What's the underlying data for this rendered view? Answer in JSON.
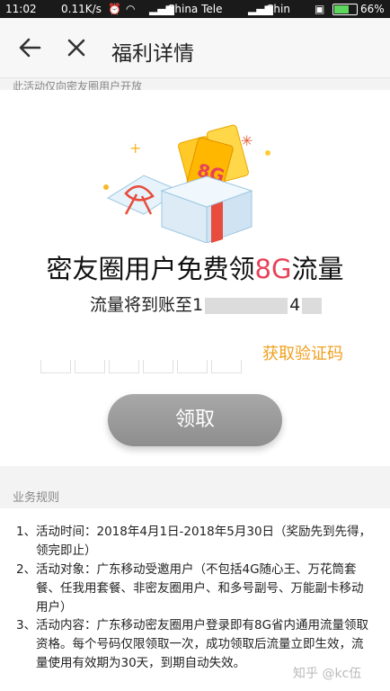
{
  "status_bar": {
    "time": "11:02",
    "speed": "0.11K/s",
    "carrier1": "China Tele",
    "carrier2": "Chin",
    "battery": "66%"
  },
  "app_bar": {
    "title": "福利详情"
  },
  "notice": "此活动仅向密友圈用户开放",
  "promo": {
    "headline_prefix": "密友圈用户免费领",
    "headline_accent": "8G",
    "headline_suffix": "流量",
    "account_label": "流量将到账至",
    "account_visible_1": "1",
    "account_visible_2": "4",
    "gift_ticket_text": "8G",
    "get_code_label": "获取验证码",
    "claim_button": "领取"
  },
  "rules": {
    "heading": "业务规则",
    "items": [
      {
        "num": "1、",
        "text": "活动时间：2018年4月1日-2018年5月30日（奖励先到先得，领完即止）"
      },
      {
        "num": "2、",
        "text": "活动对象：广东移动受邀用户（不包括4G随心王、万花筒套餐、任我用套餐、非密友圈用户、和多号副号、万能副卡移动用户）"
      },
      {
        "num": "3、",
        "text": "活动内容：广东移动密友圈用户登录即有8G省内通用流量领取资格。每个号码仅限领取一次，成功领取后流量立即生效，流量使用有效期为30天，到期自动失效。"
      }
    ]
  },
  "watermark": "知乎 @kc伍",
  "colors": {
    "accent_red": "#e8425a",
    "link_orange": "#f0a020",
    "button_gray": "#9a9a9a"
  }
}
